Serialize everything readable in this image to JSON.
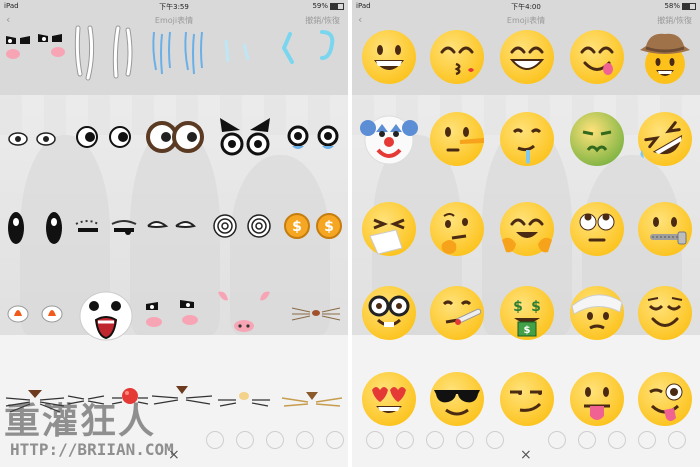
{
  "status_left": {
    "device": "iPad",
    "time": "下午3:59",
    "battery": "59%"
  },
  "status_right": {
    "device": "iPad",
    "time": "下午4:00",
    "battery": "58%"
  },
  "nav_left": {
    "back_icon": "chevron-left-icon",
    "title": "Emoji表情",
    "action": "撤銷/恢復"
  },
  "nav_right": {
    "back_icon": "chevron-left-icon",
    "title": "Emoji表情",
    "action": "撤銷/恢復"
  },
  "close_label": "×",
  "watermark": {
    "line1": "重灌狂人",
    "line2": "HTTP://BRIIAN.COM"
  },
  "left_stickers": [
    "blush-eyes-sticker",
    "blush-eyes-sticker",
    "sweat-drops-sticker",
    "sweat-drops-sticker",
    "blue-tears-sticker",
    "blue-tears-sticker",
    "cyan-lines-sticker",
    "cyan-lines-sticker",
    "dizzy-eyes-sticker",
    "dizzy-eyes-sticker",
    "round-eyes-sticker",
    "round-eyes-sticker",
    "brown-eyes-sticker",
    "angry-eyes-sticker",
    "crying-eyes-sticker",
    "crying-eyes-sticker",
    "oval-eyes-sticker",
    "oval-eyes-sticker",
    "sleepy-eyes-sticker",
    "sleepy-eyes-sticker",
    "closed-eyes-sticker",
    "closed-eyes-sticker",
    "spiral-eyes-sticker",
    "spiral-eyes-sticker",
    "coin-eyes-sticker",
    "coin-eyes-sticker",
    "fire-eyes-sticker",
    "fire-eyes-sticker",
    "shocked-face-sticker",
    "shocked-face-sticker",
    "blush-eyes-sticker",
    "blush-eyes-sticker",
    "pink-ears-sticker",
    "pig-nose-sticker",
    "whiskers-sticker",
    "cat-whiskers-sticker",
    "cat-whiskers-sticker",
    "red-nose-sticker",
    "mouse-whiskers-sticker",
    "bunny-nose-sticker",
    "tiger-whiskers-sticker"
  ],
  "right_emojis": [
    [
      "grinning-face",
      "kissing-face",
      "smiling-face",
      "face-savoring-food",
      "cowboy-face"
    ],
    [
      "clown-face",
      "lying-face",
      "drooling-face",
      "nauseated-face",
      "rolling-laughing-face"
    ],
    [
      "sneezing-face",
      "thinking-face",
      "hugging-face",
      "rolling-eyes-face",
      "zipper-mouth-face"
    ],
    [
      "nerd-face",
      "thermometer-face",
      "money-mouth-face",
      "bandage-face",
      "relieved-face"
    ],
    [
      "heart-eyes-face",
      "sunglasses-face",
      "smirking-face",
      "tongue-out-face",
      "winking-tongue-face"
    ]
  ],
  "colors": {
    "emoji_yellow": "#fcc21b",
    "emoji_orange": "#f7a21b",
    "nausea_green": "#7cb342",
    "heart_red": "#e53935"
  }
}
